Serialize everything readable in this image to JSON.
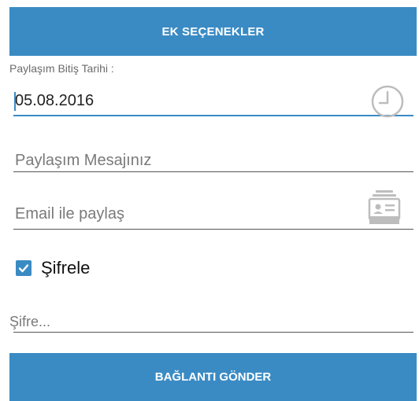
{
  "header_button": {
    "label": "EK SEÇENEKLER"
  },
  "expiry": {
    "label": "Paylaşım Bitiş Tarihi :",
    "value": "05.08.2016",
    "icon": "clock-icon"
  },
  "message": {
    "placeholder": "Paylaşım Mesajınız"
  },
  "email": {
    "placeholder": "Email ile paylaş",
    "icon": "contacts-icon"
  },
  "encrypt": {
    "label": "Şifrele",
    "checked": true
  },
  "password": {
    "placeholder": "Şifre..."
  },
  "footer_button": {
    "label": "BAĞLANTI GÖNDER"
  },
  "colors": {
    "accent": "#3a8bc4",
    "icon_gray": "#bdbdbd"
  }
}
